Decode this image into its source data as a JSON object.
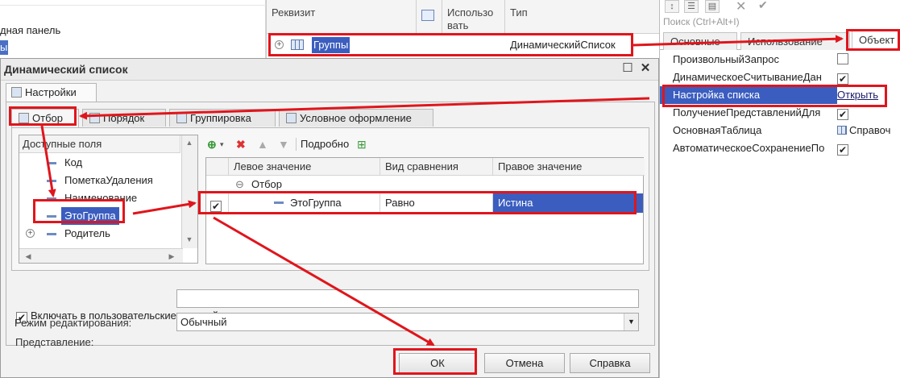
{
  "background_panel": {
    "text1": "дная панель",
    "text2": "ы"
  },
  "requisites_table": {
    "columns": [
      "Реквизит",
      "Использо вать",
      "Тип"
    ],
    "row": {
      "name": "Группы",
      "type": "ДинамическийСписок"
    }
  },
  "properties_panel": {
    "search_placeholder": "Поиск (Ctrl+Alt+I)",
    "tabs": [
      "Основные",
      "Использование",
      "Объект"
    ],
    "rows": [
      {
        "name": "ПроизвольныйЗапрос",
        "value": "",
        "checked": false
      },
      {
        "name": "ДинамическоеСчитываниеДан",
        "value": "",
        "checked": true
      },
      {
        "name": "Настройка списка",
        "value": "Открыть",
        "checked": null
      },
      {
        "name": "ПолучениеПредставленийДля",
        "value": "",
        "checked": true
      },
      {
        "name": "ОсновнаяТаблица",
        "value": "Справоч",
        "checked": null
      },
      {
        "name": "АвтоматическоеСохранениеПо",
        "value": "",
        "checked": true
      }
    ]
  },
  "dialog": {
    "title": "Динамический список",
    "outer_tab": "Настройки",
    "inner_tabs": [
      "Отбор",
      "Порядок",
      "Группировка",
      "Условное оформление"
    ],
    "available_fields_header": "Доступные поля",
    "available_fields": [
      "Код",
      "ПометкаУдаления",
      "Наименование",
      "ЭтоГруппа",
      "Родитель"
    ],
    "toolbar_detail_label": "Подробно",
    "filter_columns": [
      "Левое значение",
      "Вид сравнения",
      "Правое значение"
    ],
    "filter_group": "Отбор",
    "filter_row": {
      "left": "ЭтоГруппа",
      "comparison": "Равно",
      "right": "Истина"
    },
    "include_in_user_settings": "Включать в пользовательские настройк...",
    "presentation_label": "Представление:",
    "presentation_value": "",
    "edit_mode_label": "Режим редактирования:",
    "edit_mode_value": "Обычный",
    "buttons": {
      "ok": "ОК",
      "cancel": "Отмена",
      "help": "Справка"
    }
  },
  "colors": {
    "annotation_red": "#e0151c",
    "selection_blue": "#3b5dbf"
  }
}
